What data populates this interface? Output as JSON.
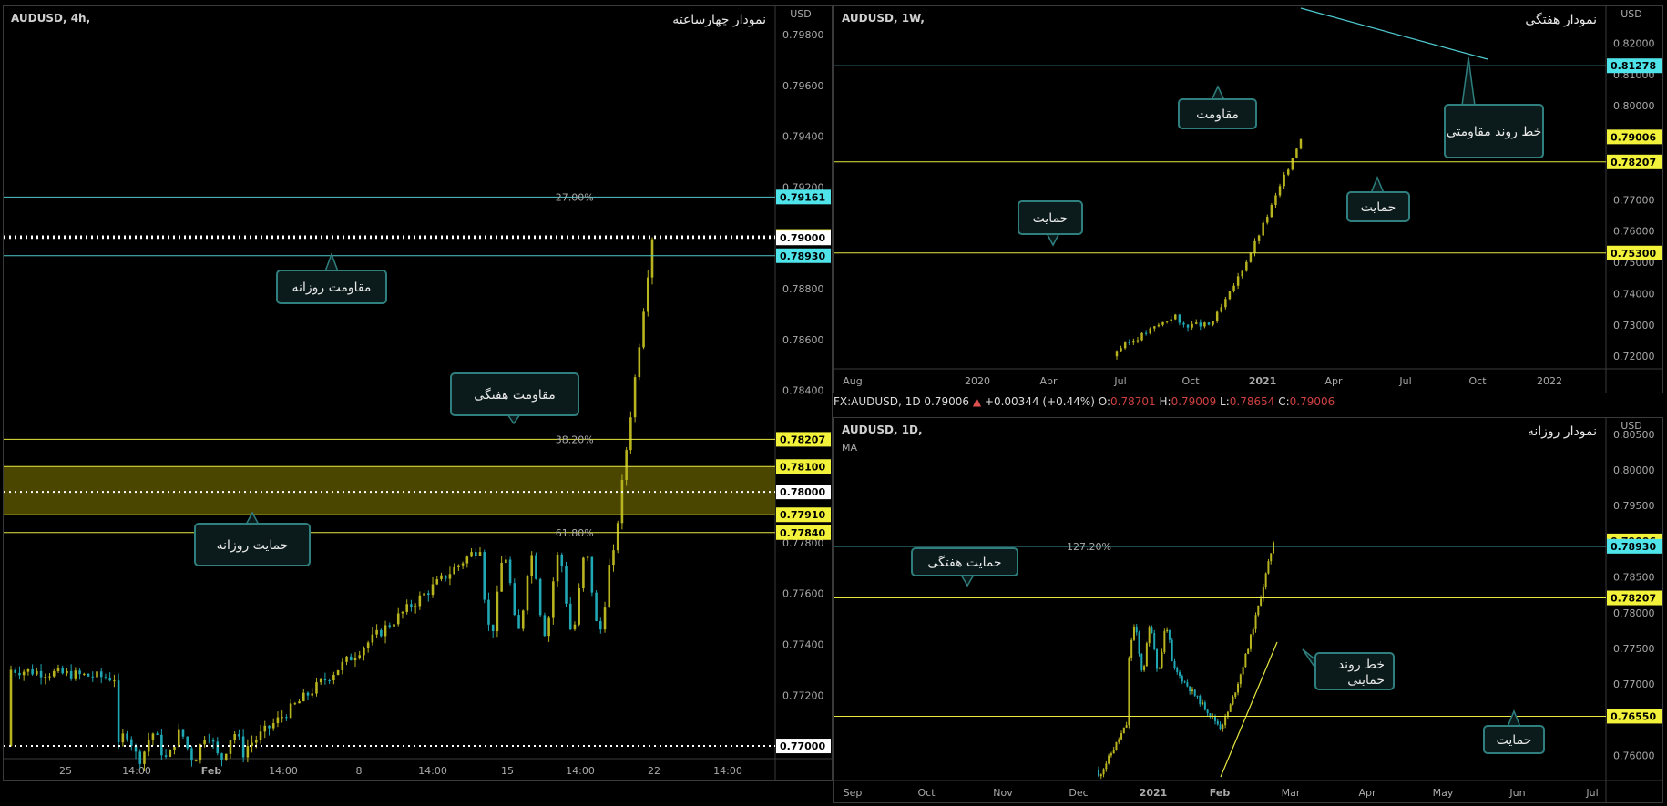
{
  "colors": {
    "bg": "#000000",
    "up": "#b8b41f",
    "down": "#1fa7b4",
    "support": "#e8e840",
    "resistance": "#4fc9d0",
    "callout_bg": "#0b1a1a",
    "callout_border": "#2f7f7f"
  },
  "infobar": {
    "symbol": "FX:AUDUSD",
    "tf": "1D",
    "price": "0.79006",
    "arrow": "▲",
    "change": "+0.00344 (+0.44%)",
    "o_lbl": "O:",
    "o": "0.78701",
    "h_lbl": "H:",
    "h": "0.79009",
    "l_lbl": "L:",
    "l": "0.78654",
    "c_lbl": "C:",
    "c": "0.79006"
  },
  "chart_data": [
    {
      "id": "h4",
      "type": "candlestick",
      "title": "AUDUSD, 4h,",
      "title_fa": "نمودار چهارساعته",
      "currency": "USD",
      "ylim": [
        0.7695,
        0.7989
      ],
      "y_ticks": [
        "0.79800",
        "0.79600",
        "0.79400",
        "0.79200",
        "0.78800",
        "0.78600",
        "0.78400",
        "0.77800",
        "0.77600",
        "0.77400",
        "0.77200"
      ],
      "x_ticks": [
        "25",
        "14:00",
        "Feb",
        "14:00",
        "8",
        "14:00",
        "15",
        "14:00",
        "22",
        "14:00"
      ],
      "lines": [
        {
          "price": 0.79161,
          "label": "0.79161",
          "kind": "resistance",
          "note": "27.00%"
        },
        {
          "price": 0.79006,
          "label": "0.79006",
          "kind": "dotted"
        },
        {
          "price": 0.79,
          "label": "0.79000",
          "kind": "level-white"
        },
        {
          "price": 0.7893,
          "label": "0.78930",
          "kind": "resistance"
        },
        {
          "price": 0.78207,
          "label": "0.78207",
          "kind": "support",
          "note": "38.20%"
        },
        {
          "price": 0.781,
          "label": "0.78100",
          "kind": "support"
        },
        {
          "price": 0.78,
          "label": "0.78000",
          "kind": "level-white"
        },
        {
          "price": 0.7791,
          "label": "0.77910",
          "kind": "support"
        },
        {
          "price": 0.7784,
          "label": "0.77840",
          "kind": "support",
          "note": "61.80%"
        },
        {
          "price": 0.77,
          "label": "0.77000",
          "kind": "level-white"
        }
      ],
      "zone": [
        0.7791,
        0.781
      ],
      "callouts": [
        "مقاومت روزانه",
        "مقاومت هفتگی",
        "حمایت روزانه"
      ]
    },
    {
      "id": "w1",
      "type": "candlestick",
      "title": "AUDUSD, 1W,",
      "title_fa": "نمودار هفتگی",
      "currency": "USD",
      "ylim": [
        0.716,
        0.83
      ],
      "y_ticks": [
        "0.82000",
        "0.81000",
        "0.80000",
        "0.77000",
        "0.76000",
        "0.75000",
        "0.74000",
        "0.73000",
        "0.72000"
      ],
      "x_ticks": [
        "Aug",
        "2020",
        "Apr",
        "Jul",
        "Oct",
        "2021",
        "Apr",
        "Jul",
        "Oct",
        "2022"
      ],
      "lines": [
        {
          "price": 0.81278,
          "label": "0.81278",
          "kind": "resistance"
        },
        {
          "price": 0.79006,
          "label": "0.79006",
          "kind": "support-label-only"
        },
        {
          "price": 0.78207,
          "label": "0.78207",
          "kind": "support"
        },
        {
          "price": 0.753,
          "label": "0.75300",
          "kind": "support"
        }
      ],
      "callouts": [
        "مقاومت",
        "حمایت",
        "حمایت",
        "خط روند مقاومتی"
      ]
    },
    {
      "id": "d1",
      "type": "candlestick",
      "title": "AUDUSD, 1D,",
      "title_fa": "نمودار روزانه",
      "currency": "USD",
      "indicator": "MA",
      "ylim": [
        0.7565,
        0.8065
      ],
      "y_ticks": [
        "0.80500",
        "0.80000",
        "0.79500",
        "0.78500",
        "0.78000",
        "0.77500",
        "0.77000",
        "0.76000"
      ],
      "x_ticks": [
        "Sep",
        "Oct",
        "Nov",
        "Dec",
        "2021",
        "Feb",
        "Mar",
        "Apr",
        "May",
        "Jun",
        "Jul"
      ],
      "lines": [
        {
          "price": 0.79006,
          "label": "0.79006",
          "kind": "support-label-only"
        },
        {
          "price": 0.7893,
          "label": "0.78930",
          "kind": "resistance",
          "note": "127.20%"
        },
        {
          "price": 0.78207,
          "label": "0.78207",
          "kind": "support"
        },
        {
          "price": 0.7655,
          "label": "0.76550",
          "kind": "support"
        }
      ],
      "callouts": [
        "حمایت هفتگی",
        "خط روند حمایتی",
        "حمایت"
      ]
    }
  ]
}
